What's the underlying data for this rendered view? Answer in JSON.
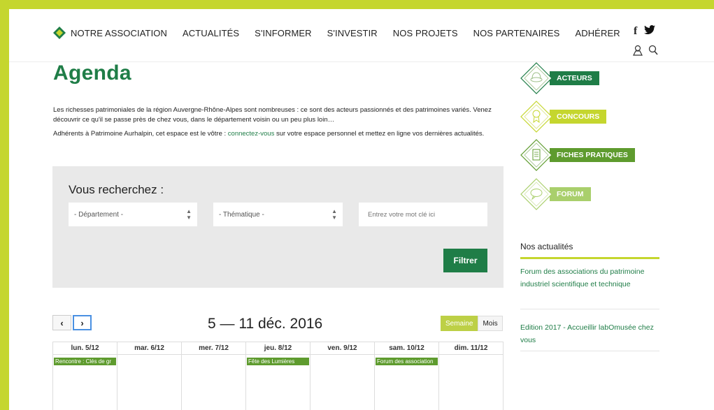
{
  "colors": {
    "frame": "#c5d62e",
    "brand_green": "#1f7d47",
    "event_green": "#5e9b2e",
    "lime": "#bdd046"
  },
  "nav": {
    "logo_label": "NOTRE ASSOCIATION",
    "items": [
      "ACTUALITÉS",
      "S'INFORMER",
      "S'INVESTIR",
      "NOS PROJETS",
      "NOS PARTENAIRES",
      "ADHÉRER"
    ],
    "social": {
      "facebook": "f",
      "twitter": "twitter-icon"
    }
  },
  "page": {
    "title": "Agenda",
    "intro_1": "Les richesses patrimoniales de la région Auvergne-Rhône-Alpes sont nombreuses : ce sont des acteurs passionnés et des patrimoines variés. Venez découvrir ce qu'il se passe près de chez vous, dans le département voisin ou un peu plus loin…",
    "intro_2_before": "Adhérents à Patrimoine Aurhalpin, cet espace est le vôtre : ",
    "intro_2_link": "connectez-vous",
    "intro_2_after": " sur votre espace personnel et mettez en ligne vos dernières actualités."
  },
  "search": {
    "title": "Vous recherchez :",
    "department": "- Département -",
    "thematic": "- Thématique -",
    "keyword_placeholder": "Entrez votre mot clé ici",
    "filter_label": "Filtrer"
  },
  "calendar": {
    "prev": "‹",
    "next": "›",
    "title": "5 — 11 déc. 2016",
    "view_week": "Semaine",
    "view_month": "Mois",
    "days": [
      "lun. 5/12",
      "mar. 6/12",
      "mer. 7/12",
      "jeu. 8/12",
      "ven. 9/12",
      "sam. 10/12",
      "dim. 11/12"
    ],
    "events": [
      {
        "day": 0,
        "label": "Rencontre : Clés de gr"
      },
      {
        "day": 3,
        "label": "Fête des Lumières"
      },
      {
        "day": 5,
        "label": "Forum des association"
      }
    ]
  },
  "sidebar": {
    "links": [
      {
        "label": "ACTEURS",
        "color": "#1f7d47",
        "icon": "hat-icon"
      },
      {
        "label": "CONCOURS",
        "color": "#c5d62e",
        "icon": "medal-icon"
      },
      {
        "label": "FICHES PRATIQUES",
        "color": "#5e9b2e",
        "icon": "document-icon"
      },
      {
        "label": "FORUM",
        "color": "#a9cf6c",
        "icon": "speech-bubble-icon"
      }
    ],
    "news_title": "Nos actualités",
    "news": [
      "Forum des associations du patrimoine industriel scientifique et technique",
      "Edition 2017 - Accueillir labOmusée chez vous"
    ]
  }
}
